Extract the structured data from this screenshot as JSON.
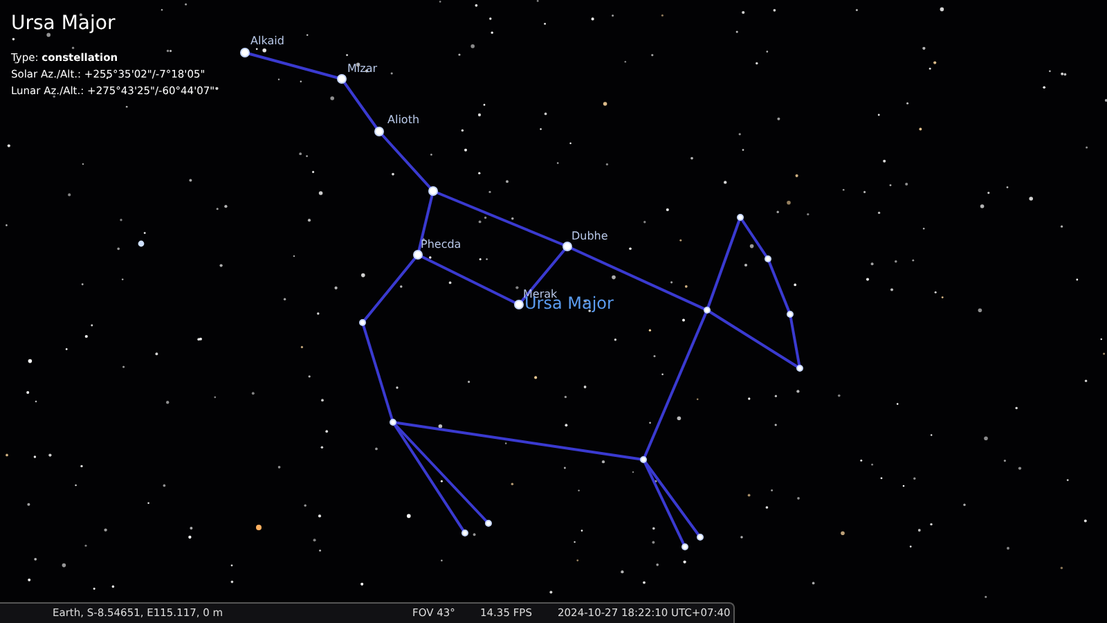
{
  "info_panel": {
    "title": "Ursa Major",
    "lines": [
      "Type: **constellation**",
      "Solar Az./Alt.: +255°35'02\"/-7°18'05\"",
      "Lunar Az./Alt.: +275°43'25\"/-60°44'07\""
    ]
  },
  "star_labels": [
    "Alkaid",
    "Mizar",
    "Alioth",
    "Phecda",
    "Merak",
    "Dubhe"
  ],
  "constellation_label": "Ursa Major",
  "status_bar": {
    "location": "Earth, S-8.54651, E115.117, 0 m",
    "fov": "FOV 43°",
    "fps": "14.35 FPS",
    "datetime": "2024-10-27 18:22:10 UTC+07:40"
  }
}
